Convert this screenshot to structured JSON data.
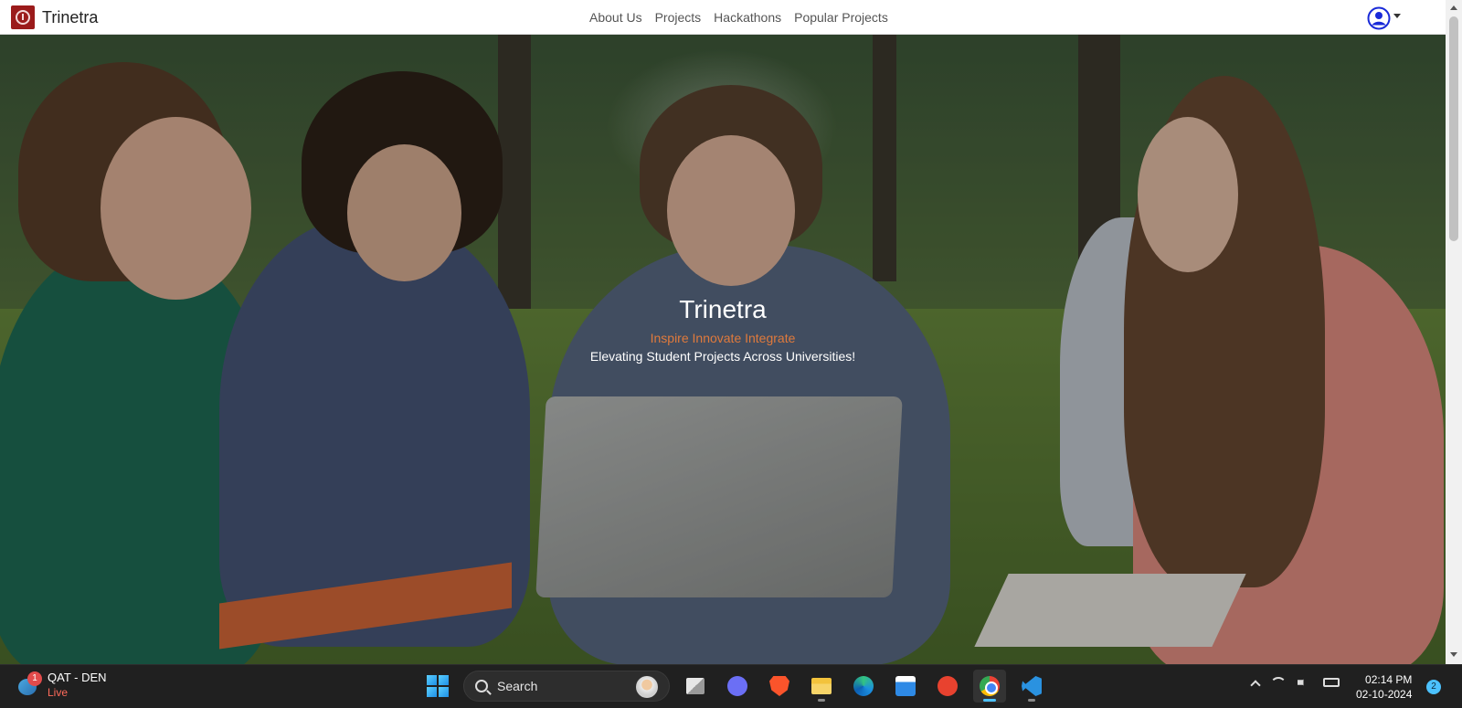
{
  "navbar": {
    "brand": "Trinetra",
    "links": [
      "About Us",
      "Projects",
      "Hackathons",
      "Popular Projects"
    ]
  },
  "hero": {
    "title": "Trinetra",
    "tagline": "Inspire Innovate Integrate",
    "subtitle": "Elevating Student Projects Across Universities!"
  },
  "taskbar": {
    "widget": {
      "badge": "1",
      "title": "QAT - DEN",
      "status": "Live"
    },
    "search_label": "Search",
    "apps": [
      "start-icon",
      "task-view-icon",
      "meet-icon",
      "brave-icon",
      "file-explorer-icon",
      "edge-icon",
      "store-icon",
      "wps-office-icon",
      "chrome-icon",
      "vscode-icon"
    ],
    "clock": {
      "time": "02:14 PM",
      "date": "02-10-2024"
    },
    "notification_count": "2"
  },
  "colors": {
    "accent_orange": "#e07a3c",
    "brand_red": "#9b1b1b",
    "taskbar_bg": "#202020"
  }
}
